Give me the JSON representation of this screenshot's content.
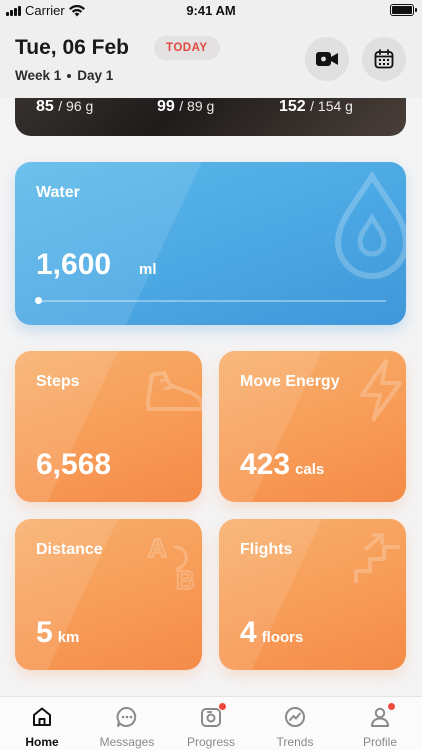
{
  "status_bar": {
    "carrier": "Carrier",
    "time": "9:41 AM"
  },
  "header": {
    "date": "Tue, 06 Feb",
    "badge": "TODAY",
    "week": "Week 1",
    "day": "Day 1",
    "video_icon": "video-camera-icon",
    "calendar_icon": "calendar-icon"
  },
  "macros": [
    {
      "value": "85",
      "target": "/ 96 g"
    },
    {
      "value": "99",
      "target": "/ 89 g"
    },
    {
      "value": "152",
      "target": "/ 154 g"
    }
  ],
  "water": {
    "label": "Water",
    "value": "1,600",
    "unit": "ml",
    "progress": 0.0,
    "icon": "water-drop-icon"
  },
  "steps": {
    "label": "Steps",
    "value": "6,568",
    "icon": "sneaker-icon"
  },
  "move_energy": {
    "label": "Move Energy",
    "value": "423",
    "unit": "cals",
    "icon": "lightning-icon"
  },
  "distance": {
    "label": "Distance",
    "value": "5",
    "unit": "km",
    "icon": "a-to-b-icon"
  },
  "flights": {
    "label": "Flights",
    "value": "4",
    "unit": "floors",
    "icon": "stairs-icon"
  },
  "tabs": [
    {
      "label": "Home",
      "icon": "home-icon",
      "active": true
    },
    {
      "label": "Messages",
      "icon": "chat-icon",
      "active": false
    },
    {
      "label": "Progress",
      "icon": "camera-icon",
      "active": false,
      "badge": true
    },
    {
      "label": "Trends",
      "icon": "trend-icon",
      "active": false
    },
    {
      "label": "Profile",
      "icon": "person-icon",
      "active": false,
      "badge": true
    }
  ],
  "colors": {
    "accent": "#e2473c",
    "water_blue": "#4aa6e2",
    "tile_orange": "#f79a55"
  }
}
